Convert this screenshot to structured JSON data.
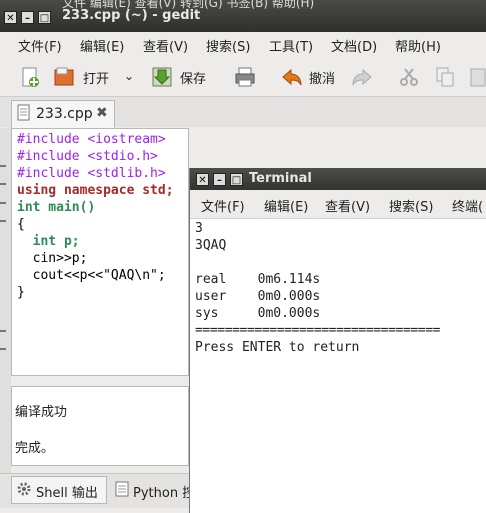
{
  "gedit": {
    "behind_menu_text": "文件    编辑(E)   查看(V)   转到(G)   书签(B)   帮助(H)",
    "title": "233.cpp (~) - gedit",
    "menu": [
      "文件(F)",
      "编辑(E)",
      "查看(V)",
      "搜索(S)",
      "工具(T)",
      "文档(D)",
      "帮助(H)"
    ],
    "toolbar": {
      "open_label": "打开",
      "save_label": "保存",
      "undo_label": "撤消"
    },
    "tab_label": "233.cpp",
    "tab_close": "✖",
    "code": [
      "#include <iostream>",
      "#include <stdio.h>",
      "#include <stdlib.h>",
      "using namespace std;",
      "int main()",
      "{",
      "  int p;",
      "  cin>>p;",
      "  cout<<p<<\"QAQ\\n\";",
      "}"
    ],
    "output": [
      "编译成功",
      "完成。"
    ],
    "bottom_tabs": [
      "Shell 输出",
      "Python 控"
    ]
  },
  "terminal": {
    "title": "Terminal",
    "menu": [
      "文件(F)",
      "编辑(E)",
      "查看(V)",
      "搜索(S)",
      "终端("
    ],
    "lines": [
      "3",
      "3QAQ",
      "",
      "real    0m6.114s",
      "user    0m0.000s",
      "sys     0m0.000s",
      "=================================",
      "Press ENTER to return"
    ]
  }
}
